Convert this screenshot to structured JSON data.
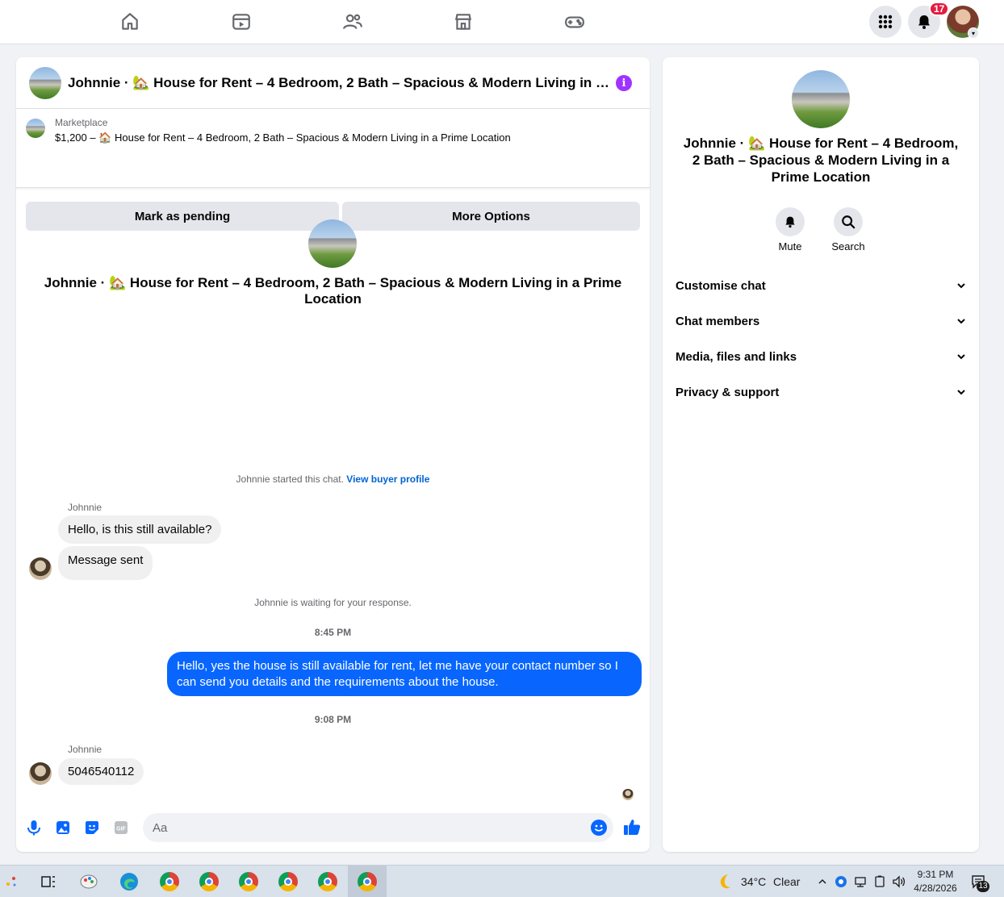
{
  "nav": {
    "icons": [
      "home-icon",
      "video-icon",
      "friends-icon",
      "marketplace-icon",
      "gaming-icon"
    ],
    "notifications_count": "17"
  },
  "chat": {
    "header_title": "Johnnie · 🏡 House for Rent – 4 Bedroom, 2 Bath – Spacious & Modern Living in a Prime Location",
    "marketplace_label": "Marketplace",
    "listing": "$1,200 – 🏠 House for Rent – 4 Bedroom, 2 Bath – Spacious & Modern Living in a Prime Location",
    "mark_pending_label": "Mark as pending",
    "more_options_label": "More Options",
    "intro_title": "Johnnie · 🏡 House for Rent – 4 Bedroom, 2 Bath – Spacious & Modern Living in a Prime Location",
    "started_text": "Johnnie started this chat.",
    "view_buyer_profile": "View buyer profile",
    "sender_name": "Johnnie",
    "msg_1": "Hello, is this still available?",
    "msg_2": "Message sent",
    "waiting_text": "Johnnie is waiting for your response.",
    "time_1": "8:45 PM",
    "outgoing": "Hello, yes the house is still available for rent, let me have your contact number so I can send you details and the requirements about the house.",
    "time_2": "9:08 PM",
    "msg_3": "5046540112",
    "composer_placeholder": "Aa"
  },
  "right_panel": {
    "title": "Johnnie · 🏡 House for Rent – 4 Bedroom, 2 Bath – Spacious & Modern Living in a Prime Location",
    "mute_label": "Mute",
    "search_label": "Search",
    "sections": [
      "Customise chat",
      "Chat members",
      "Media, files and links",
      "Privacy & support"
    ]
  },
  "taskbar": {
    "weather_temp": "34°C",
    "weather_desc": "Clear",
    "time": "9:31 PM",
    "date": "4/28/2026",
    "notification_count": "13"
  },
  "colors": {
    "accent": "#0866ff",
    "info": "#a033ff",
    "badge": "#e41e3f"
  }
}
